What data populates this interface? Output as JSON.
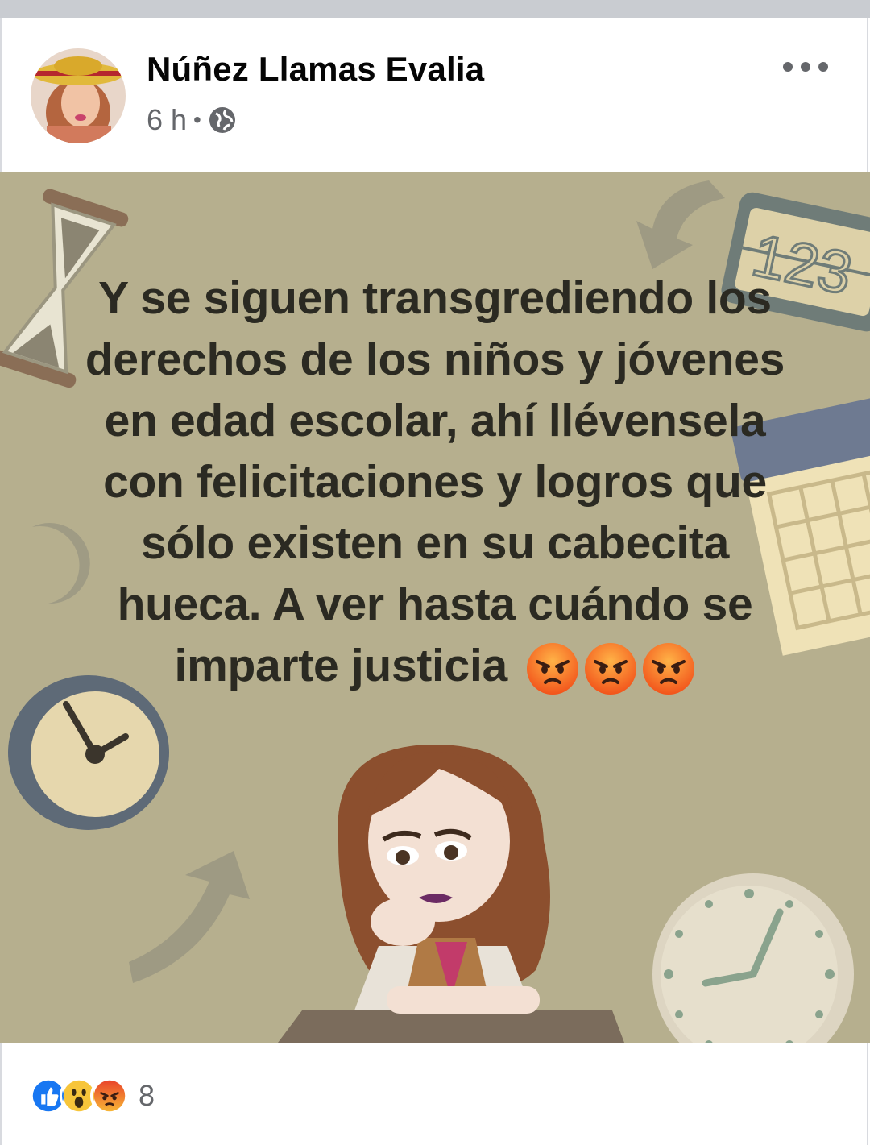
{
  "post": {
    "author": "Núñez Llamas Evalia",
    "time": "6 h",
    "separator": "•",
    "privacy_icon": "globe-icon",
    "more_icon": "more-options-icon"
  },
  "image": {
    "text": "Y se siguen transgrediendo los derechos de los niños y jóvenes en edad escolar, ahí llévensela con felicitaciones y logros que sólo existen en su cabecita hueca. A ver hasta cuándo se imparte justicia",
    "emojis": [
      "angry-face-emoji",
      "angry-face-emoji",
      "angry-face-emoji"
    ],
    "flip_clock_digits": "123",
    "bg_color": "#b6af8e"
  },
  "reactions": {
    "icons": [
      "like-reaction-icon",
      "wow-reaction-icon",
      "angry-reaction-icon"
    ],
    "count": "8"
  }
}
